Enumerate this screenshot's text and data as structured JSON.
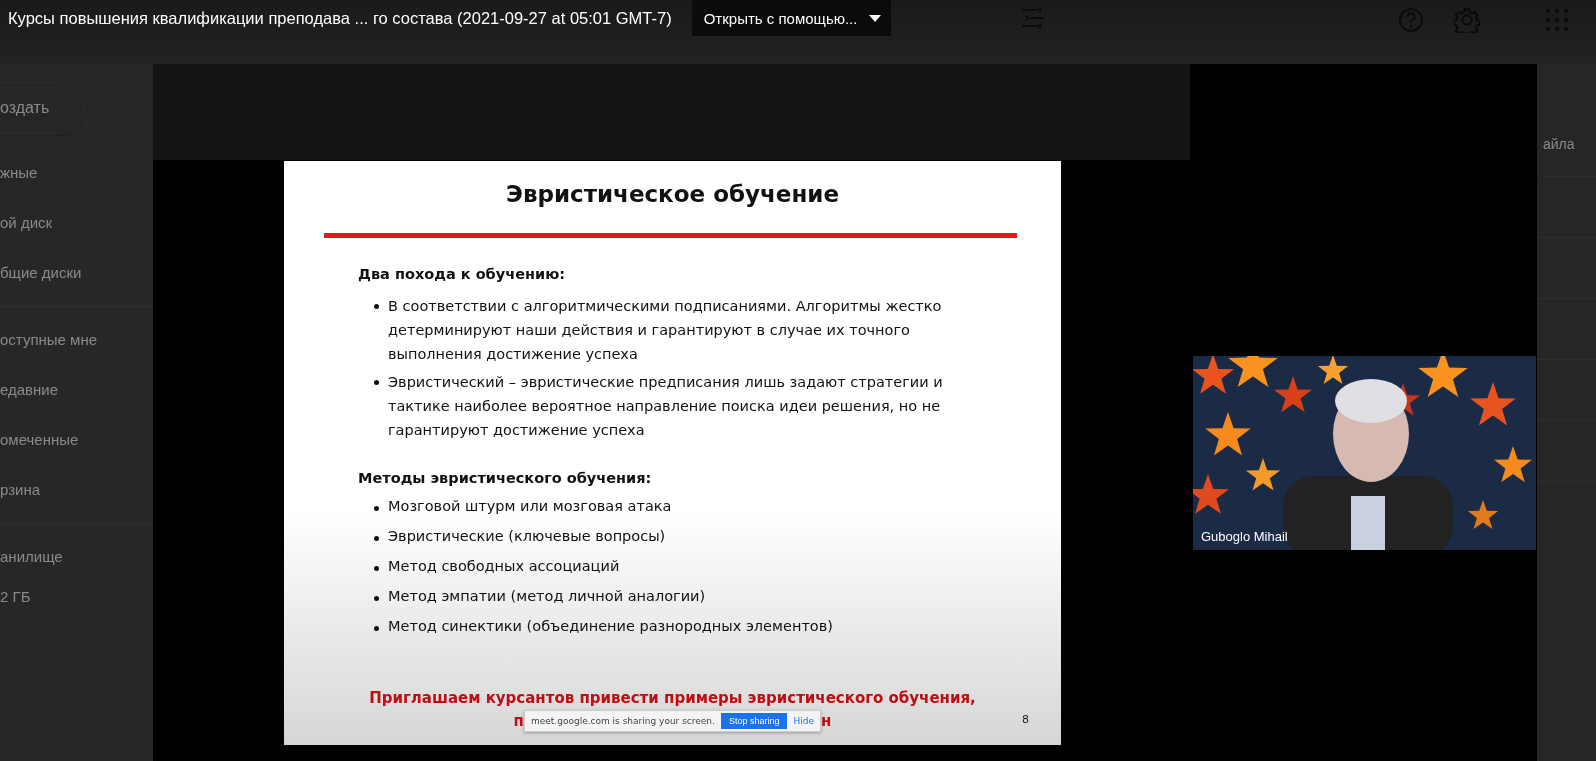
{
  "top_bar": {
    "title": "Курсы повышения квалификации преподава ... го состава (2021-09-27 at 05:01 GMT-7)",
    "open_with_button": {
      "label": "Открыть с помощью..."
    }
  },
  "sidebar": {
    "new_button": {
      "label": "оздать"
    },
    "groups": [
      [
        "жные",
        "ой диск",
        "бщие диски"
      ],
      [
        "оступные мне",
        "едавние",
        "омеченные",
        "рзина"
      ]
    ],
    "storage": {
      "label": "анилище",
      "usage": "2 ГБ"
    }
  },
  "slide": {
    "title": "Эвристическое обучение",
    "sections": [
      {
        "heading": "Два похода к обучению:",
        "bullets": [
          "В соответствии с алгоритмическими подписаниями. Алгоритмы жестко детерминируют наши действия и гарантируют в случае их точного выполнения достижение успеха",
          "Эвристический – эвристические предписания лишь задают стратегии и тактике наиболее вероятное направление поиска идеи решения, но не гарантируют достижение успеха"
        ]
      },
      {
        "heading": "Методы эвристического обучения:",
        "bullets": [
          "Мозговой штурм или мозговая атака",
          "Эвристические (ключевые вопросы)",
          "Метод свободных ассоциаций",
          "Метод эмпатии (метод личной аналогии)",
          "Метод синектики (объединение разнородных элементов)"
        ]
      }
    ],
    "footer_line_1": "Приглашаем курсантов привести примеры эвристического обучения,",
    "footer_line_2_fragments": [
      "п",
      "н"
    ],
    "page_number": "8"
  },
  "share_notice": {
    "text": "meet.google.com is sharing your screen.",
    "stop_button": "Stop sharing",
    "hide_link": "Hide"
  },
  "participant": {
    "name": "Guboglo Mihail"
  },
  "right_column": {
    "text": "айла"
  }
}
